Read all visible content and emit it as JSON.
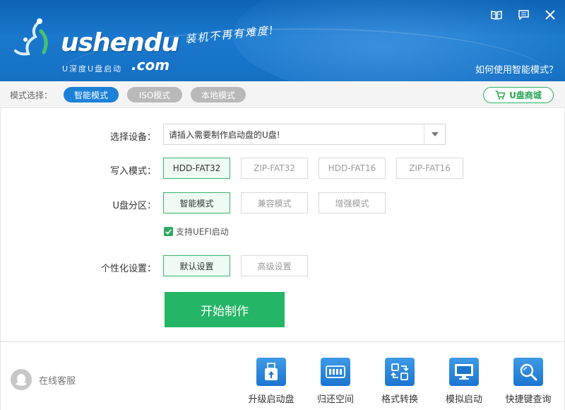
{
  "header": {
    "logo_text": "ushendu",
    "logo_sub": "U深度U盘启动",
    "logo_domain": ".com",
    "slogan": "装机不再有难度!",
    "help_link": "如何使用智能模式？"
  },
  "modebar": {
    "label": "模式选择：",
    "modes": [
      {
        "label": "智能模式",
        "active": true
      },
      {
        "label": "ISO模式",
        "active": false
      },
      {
        "label": "本地模式",
        "active": false
      }
    ],
    "shop_label": "U盘商城"
  },
  "form": {
    "device_label": "选择设备：",
    "device_value": "请插入需要制作启动盘的U盘!",
    "write_label": "写入模式：",
    "write_options": [
      "HDD-FAT32",
      "ZIP-FAT32",
      "HDD-FAT16",
      "ZIP-FAT16"
    ],
    "partition_label": "U盘分区：",
    "partition_options": [
      "智能模式",
      "兼容模式",
      "增强模式"
    ],
    "uefi_label": "支持UEFI启动",
    "uefi_checked": true,
    "personal_label": "个性化设置：",
    "personal_options": [
      "默认设置",
      "高级设置"
    ],
    "start_label": "开始制作"
  },
  "footer": {
    "service_label": "在线客服",
    "tools": [
      {
        "label": "升级启动盘",
        "icon": "upgrade-usb-icon"
      },
      {
        "label": "归还空间",
        "icon": "restore-space-icon"
      },
      {
        "label": "格式转换",
        "icon": "format-convert-icon"
      },
      {
        "label": "模拟启动",
        "icon": "simulate-boot-icon"
      },
      {
        "label": "快捷键查询",
        "icon": "hotkey-search-icon"
      }
    ]
  },
  "colors": {
    "header_blue": "#1570c4",
    "accent_blue": "#1b80d8",
    "accent_green": "#24b566"
  }
}
